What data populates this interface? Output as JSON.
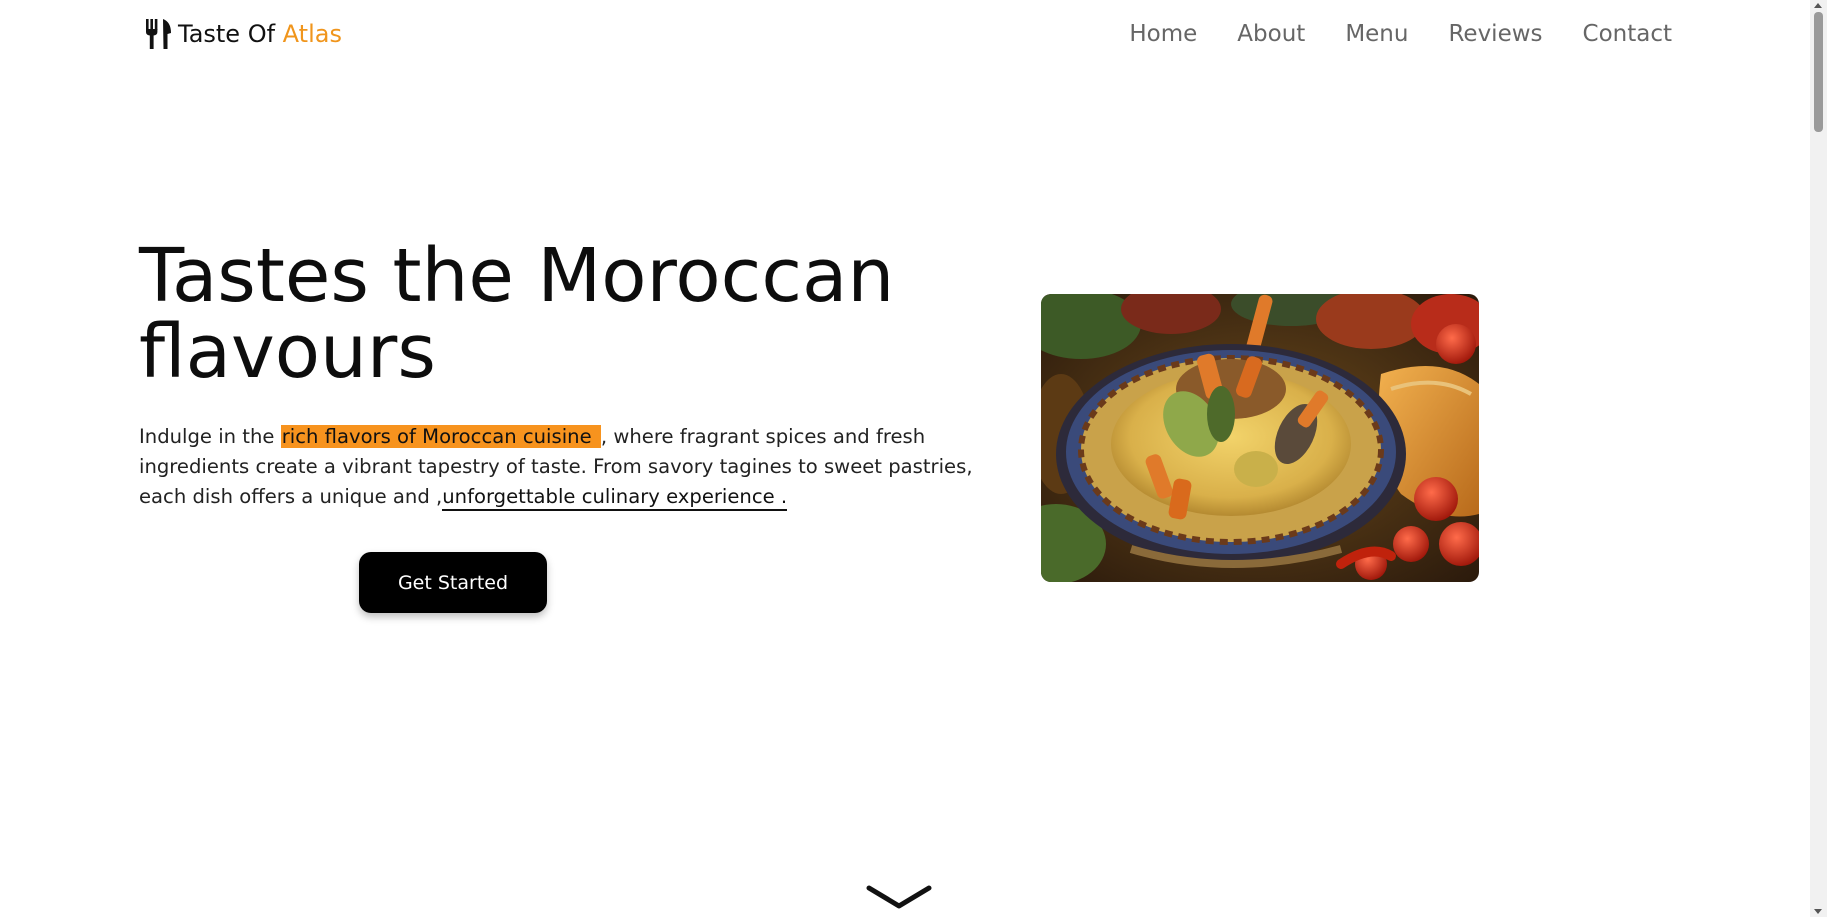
{
  "brand": {
    "name_part1": "Taste Of ",
    "name_part2": "Atlas",
    "accent_color": "#f0951c",
    "icon": "utensils-icon"
  },
  "nav": {
    "links": [
      "Home",
      "About",
      "Menu",
      "Reviews",
      "Contact"
    ]
  },
  "hero": {
    "title": "Tastes the Moroccan flavours",
    "text_before": "Indulge in the ",
    "highlight": "rich flavors of Moroccan cuisine ",
    "text_middle": ", where fragrant spices and fresh ingredients create a vibrant tapestry of taste. From savory tagines to sweet pastries, each dish offers a unique and ,",
    "link_text": "unforgettable culinary experience .",
    "highlight_color": "#f7931e",
    "cta_label": "Get Started",
    "image_icon": "moroccan-couscous-dish-image"
  },
  "scroll_indicator": {
    "icon": "chevron-down-icon"
  }
}
